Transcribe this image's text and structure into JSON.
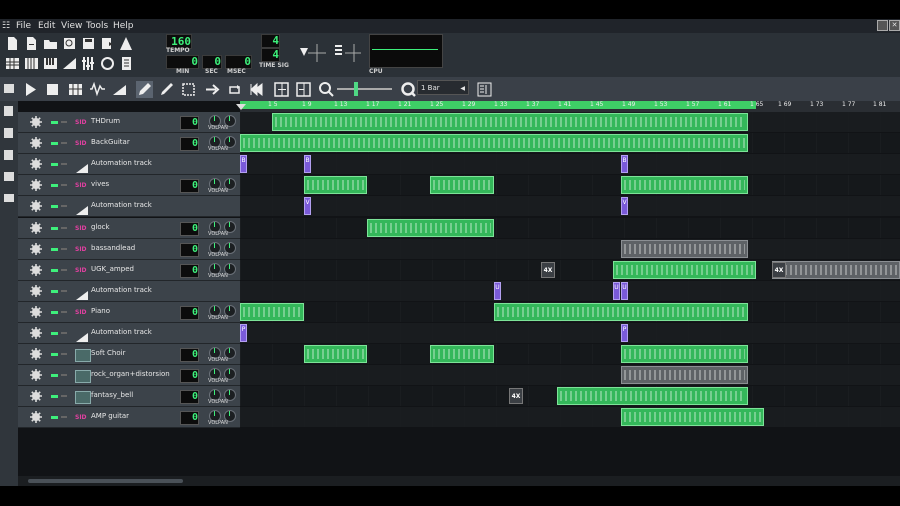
{
  "menus": [
    "File",
    "Edit",
    "View",
    "Tools",
    "Help"
  ],
  "transport": {
    "tempo": "160",
    "tempo_label": "TEMPO",
    "min": "0",
    "sec": "0",
    "msec": "0",
    "min_label": "MIN",
    "sec_label": "SEC",
    "msec_label": "MSEC",
    "timesig_top": "4",
    "timesig_bottom": "4",
    "timesig_label": "TIME SIG",
    "cpu_label": "CPU"
  },
  "quantize": "1 Bar",
  "ruler_ticks": [
    "1 5",
    "1 9",
    "1 13",
    "1 17",
    "1 21",
    "1 25",
    "1 29",
    "1 33",
    "1 37",
    "1 41",
    "1 45",
    "1 49",
    "1 53",
    "1 57",
    "1 61",
    "1 65",
    "1 69",
    "1 73",
    "1 77",
    "1 81"
  ],
  "tracks": [
    {
      "name": "THDrum",
      "type": "instrument",
      "value": "0"
    },
    {
      "name": "BackGuitar",
      "type": "instrument",
      "value": "0"
    },
    {
      "name": "Automation track",
      "type": "automation"
    },
    {
      "name": "vives",
      "type": "instrument",
      "value": "0"
    },
    {
      "name": "Automation track",
      "type": "automation"
    },
    {
      "name": "glock",
      "type": "instrument",
      "value": "0"
    },
    {
      "name": "bassandlead",
      "type": "instrument",
      "value": "0"
    },
    {
      "name": "UGK_amped",
      "type": "instrument",
      "value": "0"
    },
    {
      "name": "Automation track",
      "type": "automation"
    },
    {
      "name": "Piano",
      "type": "instrument",
      "value": "0"
    },
    {
      "name": "Automation track",
      "type": "automation"
    },
    {
      "name": "Soft Choir",
      "type": "sample",
      "value": "0"
    },
    {
      "name": "rock_organ+distorsion",
      "type": "sample",
      "value": "0"
    },
    {
      "name": "fantasy_bell",
      "type": "sample",
      "value": "0"
    },
    {
      "name": "AMP guitar",
      "type": "instrument",
      "value": "0"
    }
  ],
  "volpan_label": "VOLPAN",
  "automation_markers": [
    "B",
    "B",
    "B",
    "V",
    "V",
    "U",
    "U",
    "U",
    "P",
    "P"
  ],
  "multiplier_labels": [
    "4X",
    "4X",
    "4X"
  ],
  "colors": {
    "accent_green": "#3ece66",
    "clip_green": "#34b75a",
    "automation_purple": "#7a5ad8",
    "lcd_green": "#3ef07c"
  }
}
